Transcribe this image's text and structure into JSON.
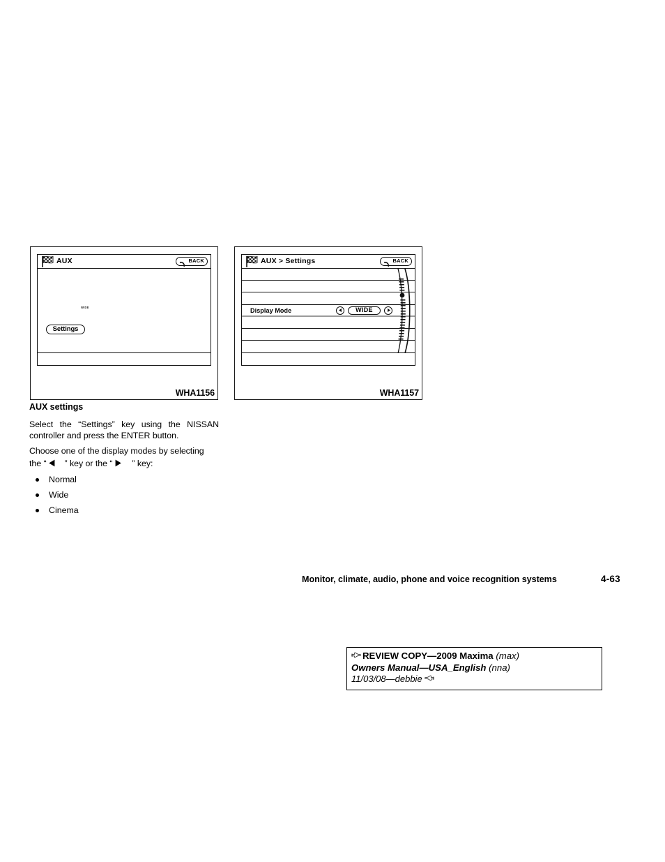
{
  "figures": [
    {
      "code": "WHA1156",
      "screen": {
        "title": "AUX",
        "back_label": "BACK",
        "mode_text": "WIDE",
        "settings_key": "Settings"
      }
    },
    {
      "code": "WHA1157",
      "screen": {
        "title": "AUX > Settings",
        "back_label": "BACK",
        "row_label": "Display Mode",
        "row_value": "WIDE"
      }
    }
  ],
  "content": {
    "heading": "AUX settings",
    "para_select": "Select the “Settings” key using the NISSAN controller and press the ENTER button.",
    "para_choose_1": "Choose one of the display modes by selecting",
    "para_choose_prefix": "the “",
    "para_choose_mid": "” key or the “",
    "para_choose_suffix": "” key:",
    "modes": [
      "Normal",
      "Wide",
      "Cinema"
    ]
  },
  "footer": {
    "chapter_title": "Monitor, climate, audio, phone and voice recognition systems",
    "page_number": "4-63"
  },
  "review": {
    "line1_caps": "REVIEW COPY—2009 Maxima",
    "line1_paren": "(max)",
    "line2_bold": "Owners Manual—USA_English",
    "line2_paren": "(nna)",
    "line3": "11/03/08—debbie"
  }
}
